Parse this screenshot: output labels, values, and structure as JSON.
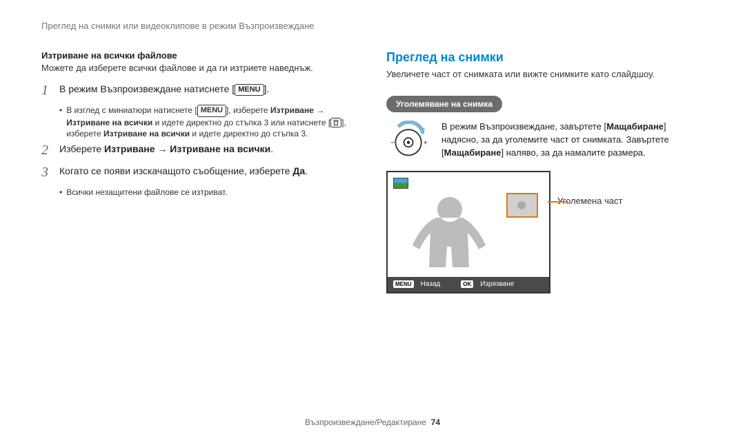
{
  "header": "Преглед на снимки или видеоклипове в режим Възпроизвеждане",
  "left": {
    "subhead": "Изтриване на всички файлове",
    "intro": "Можете да изберете всички файлове и да ги изтриете наведнъж.",
    "step1_a": "В режим Възпроизвеждане натиснете [",
    "step1_b": "].",
    "bullet1_a": "В изглед с миниатюри натиснете [",
    "bullet1_b": "], изберете ",
    "bullet1_c": "Изтриване",
    "bullet1_d": " → ",
    "bullet1_e": "Изтриване на всички",
    "bullet1_f": " и идете директно до стъпка 3 или натиснете [",
    "bullet1_g": "], изберете ",
    "bullet1_h": "Изтриване на всички",
    "bullet1_i": " и идете директно до стъпка 3.",
    "step2_a": "Изберете ",
    "step2_b": "Изтриване",
    "step2_c": " → ",
    "step2_d": "Изтриване на всички",
    "step2_e": ".",
    "step3_a": "Когато се появи изскачащото съобщение, изберете ",
    "step3_b": "Да",
    "step3_c": ".",
    "bullet3": "Всички незащитени файлове се изтриват.",
    "menu_label": "MENU"
  },
  "right": {
    "title": "Преглед на снимки",
    "intro": "Увеличете част от снимката или вижте снимките като слайдшоу.",
    "pill": "Уголемяване на снимка",
    "dial_a": "В режим Възпроизвеждане, завъртете [",
    "dial_b": "Мащабиране",
    "dial_c": "] надясно, за да уголемите част от снимката. Завъртете [",
    "dial_d": "Мащабиране",
    "dial_e": "] наляво, за да намалите размера.",
    "legend": "Уголемена част",
    "footer_menu": "MENU",
    "footer_back": "Назад",
    "footer_ok": "OK",
    "footer_crop": "Изрязване"
  },
  "footer": {
    "section": "Възпроизвеждане/Редактиране",
    "page": "74"
  },
  "nums": {
    "n1": "1",
    "n2": "2",
    "n3": "3"
  }
}
